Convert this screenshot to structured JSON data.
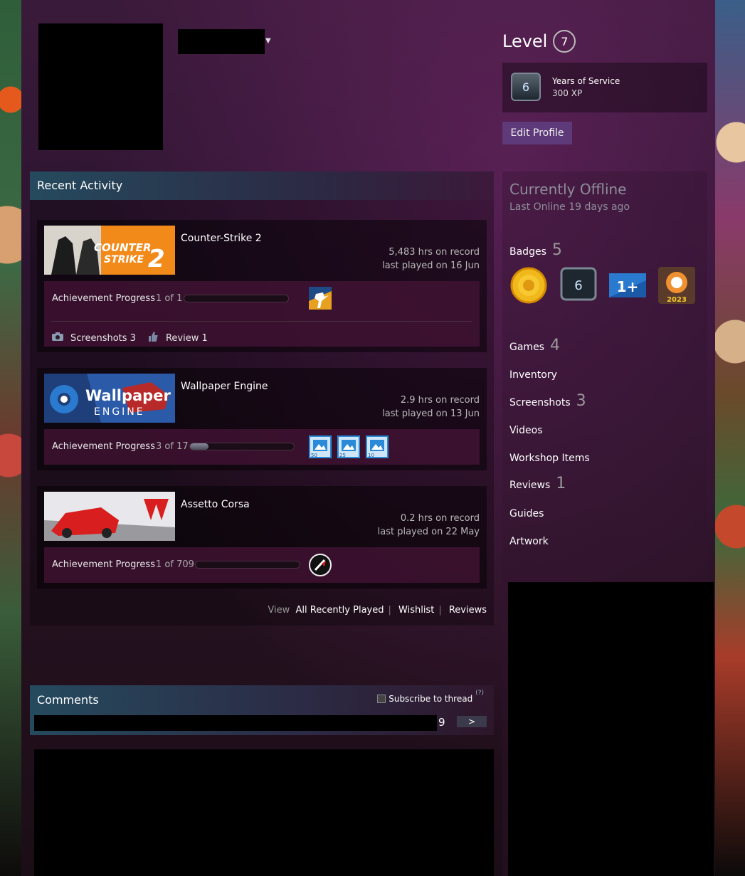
{
  "level": {
    "label": "Level",
    "value": "7"
  },
  "years_of_service": {
    "icon_number": "6",
    "title": "Years of Service",
    "xp": "300 XP"
  },
  "edit_profile_label": "Edit Profile",
  "recent_activity": {
    "title": "Recent Activity",
    "games": [
      {
        "name": "Counter-Strike 2",
        "hours": "5,483 hrs on record",
        "last_played": "last played on 16 Jun",
        "ach_label": "Achievement Progress",
        "ach_count": "1 of 1",
        "ach_fraction": 0.0,
        "screenshots_label": "Screenshots 3",
        "review_label": "Review 1",
        "cap_text": "COUNTER STRIKE 2"
      },
      {
        "name": "Wallpaper Engine",
        "hours": "2.9 hrs on record",
        "last_played": "last played on 13 Jun",
        "ach_label": "Achievement Progress",
        "ach_count": "3 of 17",
        "ach_fraction": 0.18,
        "ach_icons": [
          "50",
          "25",
          "10"
        ],
        "cap_text_top": "Wallpaper",
        "cap_text_bottom": "ENGINE"
      },
      {
        "name": "Assetto Corsa",
        "hours": "0.2 hrs on record",
        "last_played": "last played on 22 May",
        "ach_label": "Achievement Progress",
        "ach_count": "1 of 709",
        "ach_fraction": 0.0
      }
    ],
    "view": {
      "label": "View",
      "links": [
        "All Recently Played",
        "Wishlist",
        "Reviews"
      ]
    }
  },
  "comments": {
    "title": "Comments",
    "subscribe_label": "Subscribe to thread",
    "help": "(?)",
    "page": "9",
    "next": ">"
  },
  "status": {
    "state": "Currently Offline",
    "last_online": "Last Online 19 days ago"
  },
  "badges": {
    "label": "Badges",
    "count": "5",
    "years_badge_number": "6",
    "one_plus": "1+",
    "year_2023": "2023"
  },
  "links": [
    {
      "label": "Games",
      "count": "4"
    },
    {
      "label": "Inventory",
      "count": ""
    },
    {
      "label": "Screenshots",
      "count": "3"
    },
    {
      "label": "Videos",
      "count": ""
    },
    {
      "label": "Workshop Items",
      "count": ""
    },
    {
      "label": "Reviews",
      "count": "1"
    },
    {
      "label": "Guides",
      "count": ""
    },
    {
      "label": "Artwork",
      "count": ""
    }
  ],
  "colors": {
    "accent_button": "#5e3a7a",
    "header_teal": "#254a5e"
  }
}
